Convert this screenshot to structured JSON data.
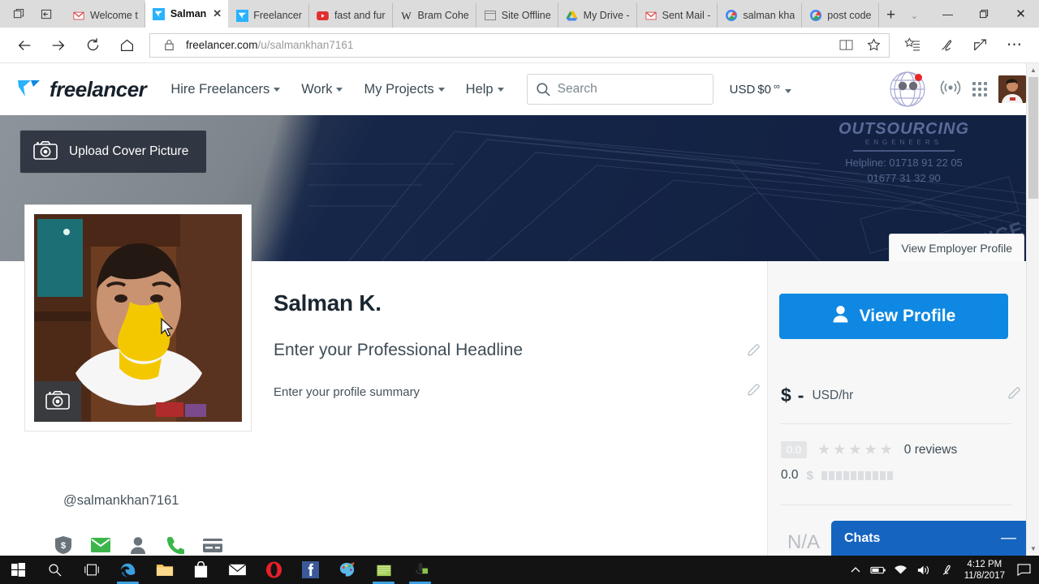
{
  "browser": {
    "sys_buttons": [
      "tab-preview-icon",
      "set-aside-tabs-icon"
    ],
    "tabs": [
      {
        "title": "Welcome t",
        "favicon": "gmail-icon",
        "active": false
      },
      {
        "title": "Salman",
        "favicon": "freelancer-icon",
        "active": true
      },
      {
        "title": "Freelancer",
        "favicon": "freelancer-icon",
        "active": false
      },
      {
        "title": "fast and fur",
        "favicon": "youtube-icon",
        "active": false
      },
      {
        "title": "Bram Cohe",
        "favicon": "wikipedia-icon",
        "active": false
      },
      {
        "title": "Site Offline",
        "favicon": "window-icon",
        "active": false
      },
      {
        "title": "My Drive -",
        "favicon": "google-drive-icon",
        "active": false
      },
      {
        "title": "Sent Mail -",
        "favicon": "gmail-icon",
        "active": false
      },
      {
        "title": "salman kha",
        "favicon": "google-icon",
        "active": false
      },
      {
        "title": "post code ",
        "favicon": "google-icon",
        "active": false
      }
    ],
    "new_tab_label": "+",
    "tab_menu_label": "⌄",
    "window_buttons": {
      "minimize": "—",
      "maximize": "❐",
      "close": "✕"
    },
    "nav_buttons": [
      "back-icon",
      "forward-icon",
      "refresh-icon",
      "home-icon"
    ],
    "address": {
      "domain": "freelancer.com",
      "path": "/u/salmankhan7161",
      "lock": "lock-icon"
    },
    "address_actions": [
      "reading-view-icon",
      "favorite-star-icon"
    ],
    "toolbar_actions": [
      "hub-favorites-icon",
      "web-note-icon",
      "share-icon",
      "more-icon"
    ]
  },
  "site": {
    "logo_text": "freelancer",
    "nav": [
      {
        "label": "Hire Freelancers"
      },
      {
        "label": "Work"
      },
      {
        "label": "My Projects"
      },
      {
        "label": "Help"
      }
    ],
    "search": {
      "placeholder": "Search",
      "value": ""
    },
    "balance": {
      "currency": "USD",
      "amount": "$0",
      "suffix": "∞"
    },
    "header_icons": [
      "globe-notifications-icon",
      "broadcast-icon",
      "apps-grid-icon",
      "user-avatar"
    ]
  },
  "cover": {
    "upload_label": "Upload Cover Picture",
    "upload_icon": "camera-icon",
    "watermark_title": "OUTSOURCING",
    "watermark_sub": "ENGENEERS",
    "watermark_helpline_1": "Helpline: 01718 91 22 05",
    "watermark_helpline_2": "01677 31 32 90",
    "watermark_cornice": "CORNICE",
    "view_employer_profile": "View Employer Profile"
  },
  "profile": {
    "photo_upload_icon": "camera-icon",
    "name": "Salman K.",
    "headline_placeholder": "Enter your Professional Headline",
    "summary_placeholder": "Enter your profile summary",
    "handle": "@salmankhan7161",
    "edit_icon": "pencil-icon",
    "verifications": [
      {
        "name": "payment-verified-icon",
        "verified": false
      },
      {
        "name": "email-verified-icon",
        "verified": true
      },
      {
        "name": "profile-completed-icon",
        "verified": false
      },
      {
        "name": "phone-verified-icon",
        "verified": true
      },
      {
        "name": "payment-method-icon",
        "verified": false
      }
    ]
  },
  "sidebar": {
    "view_profile_label": "View Profile",
    "view_profile_icon": "person-icon",
    "rate_symbol": "$",
    "rate_value": "-",
    "rate_unit": "USD/hr",
    "rating_badge": "0.0",
    "stars": 5,
    "stars_filled": 0,
    "reviews_label": "0 reviews",
    "earnings_value": "0.0",
    "earnings_icon": "dollar-icon",
    "na_label": "N/A",
    "accent_color": "#0e88e2"
  },
  "chats": {
    "title": "Chats",
    "minimize_label": "—",
    "color": "#1564c0"
  },
  "taskbar": {
    "items": [
      "start-icon",
      "search-icon",
      "task-view-icon",
      "edge-icon",
      "file-explorer-icon",
      "store-icon",
      "mail-icon",
      "opera-icon",
      "facebook-icon",
      "paint-icon",
      "notes-icon",
      "media-icon"
    ],
    "tray_icons": [
      "chevron-up-icon",
      "battery-icon",
      "wifi-icon",
      "volume-icon",
      "pen-icon"
    ],
    "time": "4:12 PM",
    "date": "11/8/2017",
    "action_center_icon": "action-center-icon"
  }
}
